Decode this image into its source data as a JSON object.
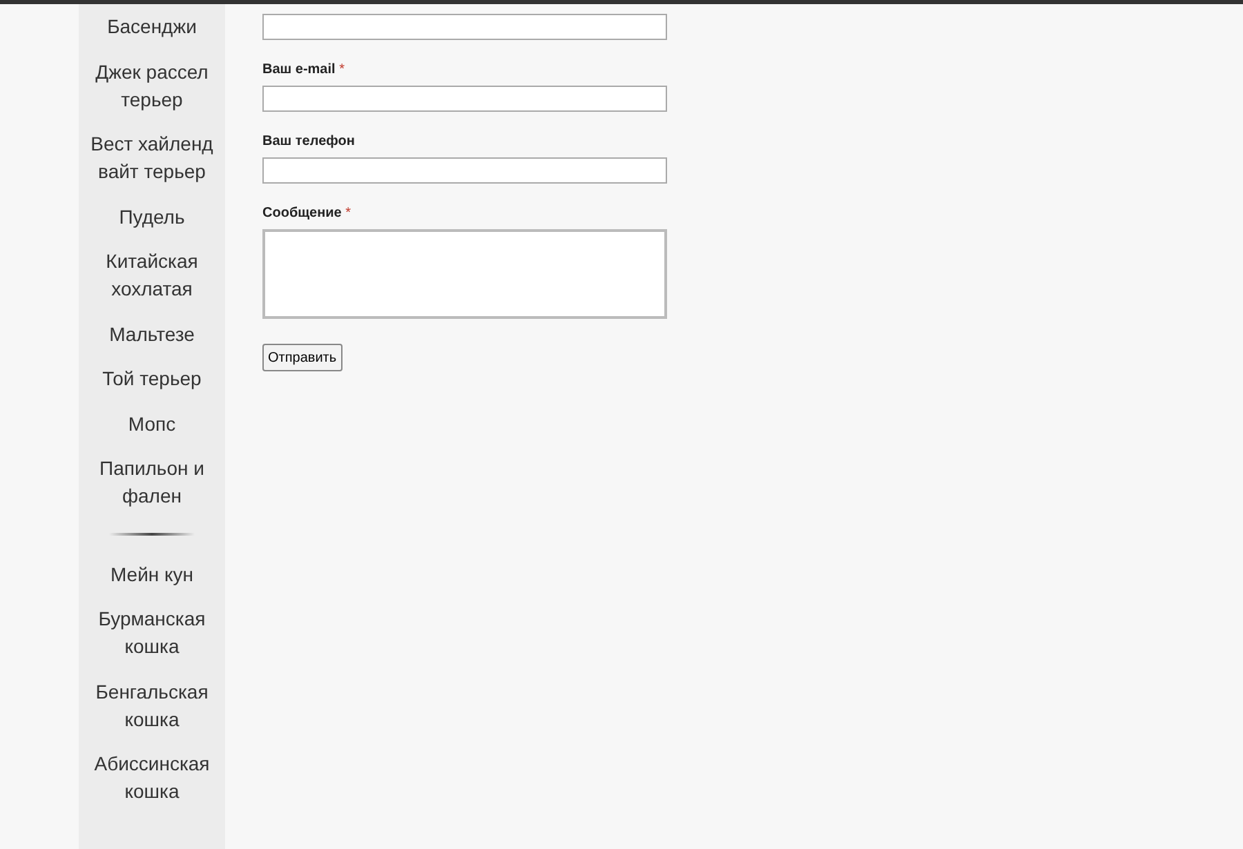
{
  "sidebar": {
    "groups": [
      {
        "items": [
          "Басенджи",
          "Джек рассел терьер",
          "Вест хайленд вайт терьер",
          "Пудель",
          "Китайская хохлатая",
          "Мальтезе",
          "Той терьер",
          "Мопс",
          "Папильон и фален"
        ]
      },
      {
        "items": [
          "Мейн кун",
          "Бурманская кошка",
          "Бенгальская кошка",
          "Абиссинская кошка"
        ]
      }
    ]
  },
  "form": {
    "fields": [
      {
        "kind": "input"
      },
      {
        "kind": "input",
        "label": "Ваш e-mail",
        "required": true
      },
      {
        "kind": "input",
        "label": "Ваш телефон",
        "required": false
      },
      {
        "kind": "textarea",
        "label": "Сообщение",
        "required": true
      }
    ],
    "required_mark": "*",
    "submit": "Отправить"
  }
}
